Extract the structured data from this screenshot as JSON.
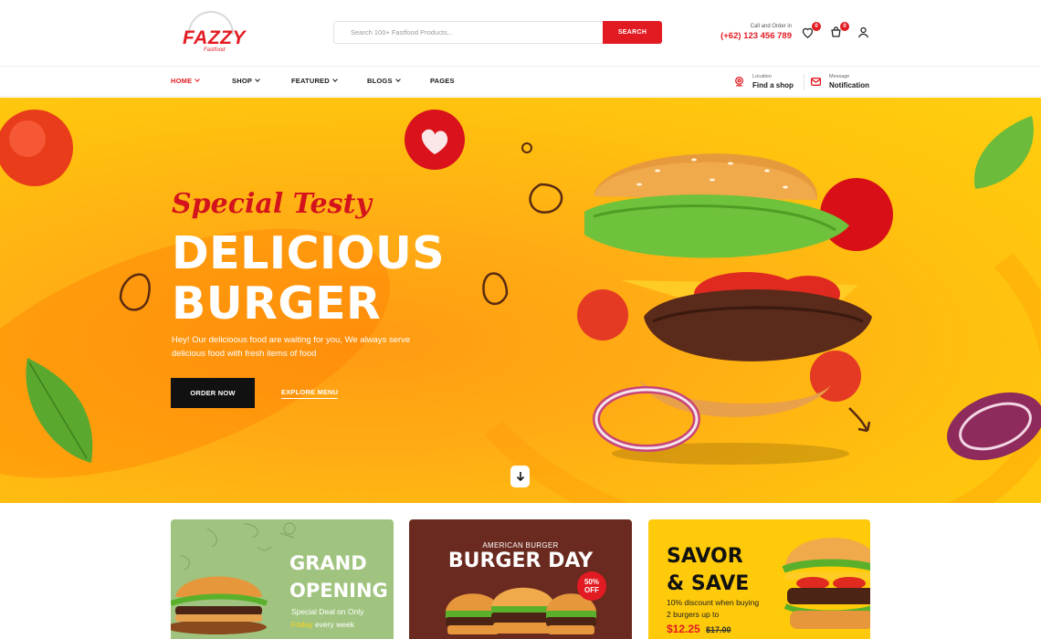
{
  "brand": {
    "name": "FAZZY",
    "tagline": "Fastfood"
  },
  "search": {
    "placeholder": "Search 100+ Fastfood Products...",
    "button": "SEARCH"
  },
  "contact": {
    "label": "Call and Order in",
    "phone": "(+62) 123 456 789"
  },
  "header_icons": {
    "wishlist_count": "0",
    "cart_count": "0"
  },
  "nav": {
    "items": [
      {
        "label": "HOME",
        "active": true
      },
      {
        "label": "SHOP"
      },
      {
        "label": "FEATURED"
      },
      {
        "label": "BLOGS"
      },
      {
        "label": "PAGES"
      }
    ],
    "location": {
      "small": "Location",
      "big": "Find a shop"
    },
    "message": {
      "small": "Message",
      "big": "Notification"
    }
  },
  "hero": {
    "tagline": "Special Testy",
    "title_line1": "DELICIOUS",
    "title_line2": "BURGER",
    "description": "Hey! Our delicioous food are waiting for you, We always serve delicious food with fresh items of food",
    "primary_button": "ORDER NOW",
    "secondary_link": "EXPLORE MENU"
  },
  "promos": {
    "grand": {
      "line1": "GRAND",
      "line2": "OPENING",
      "sub1": "Special Deal on Only",
      "sub_highlight": "Friday",
      "sub2": " every week"
    },
    "burger_day": {
      "small": "AMERICAN BURGER",
      "big": "BURGER DAY",
      "badge_top": "50%",
      "badge_bottom": "OFF"
    },
    "savor": {
      "line1": "SAVOR",
      "line2": "& SAVE",
      "desc1": "10% discount when buying",
      "desc2": "2 burgers up to",
      "price": "$12.25",
      "old_price": "$17.00"
    }
  },
  "colors": {
    "accent": "#e21b22",
    "hero_bg": "#ffb312",
    "card_green": "#a0c47f",
    "card_brown": "#6b2a1f",
    "card_yellow": "#ffca0a"
  }
}
